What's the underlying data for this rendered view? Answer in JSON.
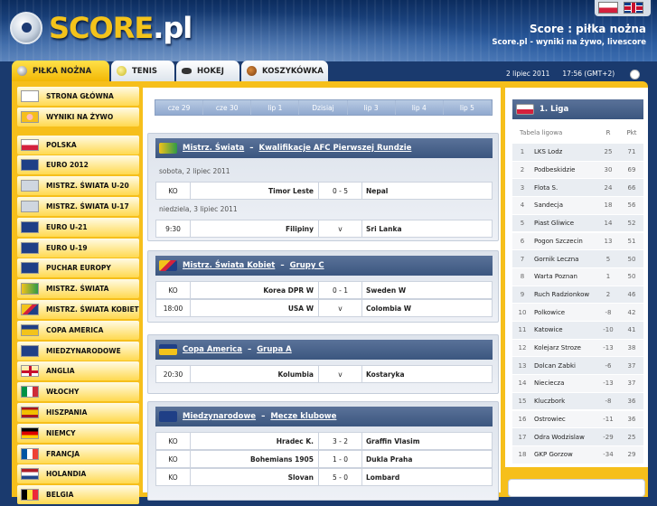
{
  "header": {
    "logo_main": "SCORE",
    "logo_suffix": ".pl",
    "title": "Score : piłka nożna",
    "subtitle": "Score.pl - wyniki na żywo, livescore",
    "flags": [
      "pl-flag",
      "uk-flag"
    ]
  },
  "tabs": [
    {
      "label": "PIŁKA NOŻNA",
      "active": true,
      "icon": "soccer-ball-icon"
    },
    {
      "label": "TENIS",
      "icon": "tennis-ball-icon"
    },
    {
      "label": "HOKEJ",
      "icon": "hockey-puck-icon"
    },
    {
      "label": "KOSZYKÓWKA",
      "icon": "basketball-icon"
    }
  ],
  "datebar": {
    "date": "2 lipiec 2011",
    "time": "17:56 (GMT+2)"
  },
  "sidebar": {
    "top": [
      {
        "label": "STRONA GŁÓWNA",
        "icon": "home-icon"
      },
      {
        "label": "WYNIKI NA ŻYWO",
        "icon": "clock-icon"
      }
    ],
    "items": [
      {
        "label": "POLSKA",
        "icon": "poland-flag-icon"
      },
      {
        "label": "EURO 2012",
        "icon": "uefa-icon"
      },
      {
        "label": "MISTRZ. ŚWIATA U-20",
        "icon": "fifa-icon"
      },
      {
        "label": "MISTRZ. ŚWIATA U-17",
        "icon": "fifa-icon"
      },
      {
        "label": "EURO U-21",
        "icon": "uefa-icon"
      },
      {
        "label": "EURO U-19",
        "icon": "uefa-icon"
      },
      {
        "label": "PUCHAR EUROPY",
        "icon": "uefa-icon"
      },
      {
        "label": "MISTRZ. ŚWIATA",
        "icon": "worldcup-icon"
      },
      {
        "label": "MISTRZ. ŚWIATA KOBIET",
        "icon": "womens-worldcup-icon"
      },
      {
        "label": "COPA AMERICA",
        "icon": "copa-america-icon"
      },
      {
        "label": "MIEDZYNARODOWE",
        "icon": "international-icon"
      },
      {
        "label": "ANGLIA",
        "icon": "england-flag-icon"
      },
      {
        "label": "WŁOCHY",
        "icon": "italy-flag-icon"
      },
      {
        "label": "HISZPANIA",
        "icon": "spain-flag-icon"
      },
      {
        "label": "NIEMCY",
        "icon": "germany-flag-icon"
      },
      {
        "label": "FRANCJA",
        "icon": "france-flag-icon"
      },
      {
        "label": "HOLANDIA",
        "icon": "netherlands-flag-icon"
      },
      {
        "label": "BELGIA",
        "icon": "belgium-flag-icon"
      }
    ]
  },
  "dates": [
    "cze 29",
    "cze 30",
    "lip 1",
    "Dzisiaj",
    "lip 3",
    "lip 4",
    "lip 5"
  ],
  "competitions": [
    {
      "name": "Mistrz. Świata",
      "sub": "Kwalifikacje AFC Pierwszej Rundzie",
      "groups": [
        {
          "day": "sobota, 2 lipiec 2011",
          "matches": [
            {
              "time": "KO",
              "home": "Timor Leste",
              "score": "0 - 5",
              "away": "Nepal"
            }
          ]
        },
        {
          "day": "niedziela, 3 lipiec 2011",
          "matches": [
            {
              "time": "9:30",
              "home": "Filipiny",
              "score": "v",
              "away": "Sri Lanka"
            }
          ]
        }
      ]
    },
    {
      "name": "Mistrz. Świata Kobiet",
      "sub": "Grupy C",
      "groups": [
        {
          "matches": [
            {
              "time": "KO",
              "home": "Korea DPR W",
              "score": "0 - 1",
              "away": "Sweden W"
            },
            {
              "time": "18:00",
              "home": "USA W",
              "score": "v",
              "away": "Colombia W"
            }
          ]
        }
      ]
    },
    {
      "name": "Copa America",
      "sub": "Grupa A",
      "groups": [
        {
          "matches": [
            {
              "time": "20:30",
              "home": "Kolumbia",
              "score": "v",
              "away": "Kostaryka"
            }
          ]
        }
      ]
    },
    {
      "name": "Miedzynarodowe",
      "sub": "Mecze klubowe",
      "groups": [
        {
          "matches": [
            {
              "time": "KO",
              "home": "Hradec K.",
              "score": "3 - 2",
              "away": "Graffin Vlasim"
            },
            {
              "time": "KO",
              "home": "Bohemians 1905",
              "score": "1 - 0",
              "away": "Dukla Praha"
            },
            {
              "time": "KO",
              "home": "Slovan",
              "score": "5 - 0",
              "away": "Lombard"
            }
          ]
        }
      ]
    }
  ],
  "league": {
    "title": "1. Liga",
    "col_team": "Tabela ligowa",
    "col_games": "R",
    "col_pts": "Pkt",
    "rows": [
      [
        "1",
        "LKS Lodz",
        "25",
        "71"
      ],
      [
        "2",
        "Podbeskidzie",
        "30",
        "69"
      ],
      [
        "3",
        "Flota S.",
        "24",
        "66"
      ],
      [
        "4",
        "Sandecja",
        "18",
        "56"
      ],
      [
        "5",
        "Piast Gliwice",
        "14",
        "52"
      ],
      [
        "6",
        "Pogon Szczecin",
        "13",
        "51"
      ],
      [
        "7",
        "Gornik Leczna",
        "5",
        "50"
      ],
      [
        "8",
        "Warta Poznan",
        "1",
        "50"
      ],
      [
        "9",
        "Ruch Radzionkow",
        "2",
        "46"
      ],
      [
        "10",
        "Polkowice",
        "-8",
        "42"
      ],
      [
        "11",
        "Katowice",
        "-10",
        "41"
      ],
      [
        "12",
        "Kolejarz Stroze",
        "-13",
        "38"
      ],
      [
        "13",
        "Dolcan Zabki",
        "-6",
        "37"
      ],
      [
        "14",
        "Nieciecza",
        "-13",
        "37"
      ],
      [
        "15",
        "Kluczbork",
        "-8",
        "36"
      ],
      [
        "16",
        "Ostrowiec",
        "-11",
        "36"
      ],
      [
        "17",
        "Odra Wodzislaw",
        "-29",
        "25"
      ],
      [
        "18",
        "GKP Gorzow",
        "-34",
        "29"
      ]
    ]
  },
  "colors": {
    "accent": "#f6bf1b",
    "header": "#3b567f"
  }
}
